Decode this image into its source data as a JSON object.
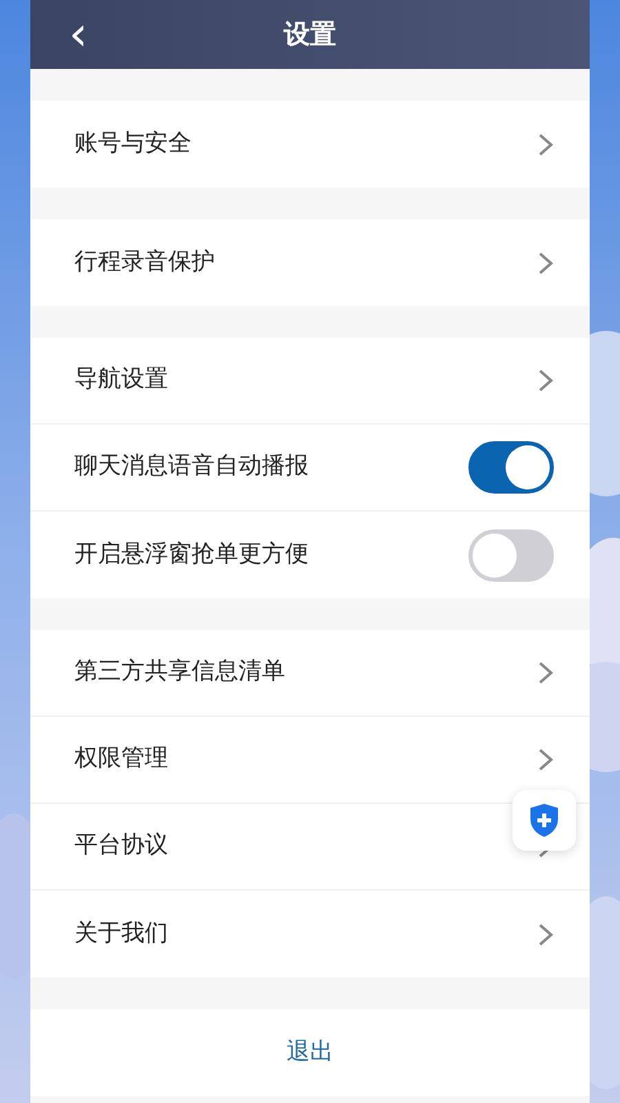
{
  "header": {
    "back": "‹",
    "title": "设置"
  },
  "groups": [
    [
      {
        "kind": "link",
        "label": "账号与安全"
      }
    ],
    [
      {
        "kind": "link",
        "label": "行程录音保护"
      }
    ],
    [
      {
        "kind": "link",
        "label": "导航设置"
      },
      {
        "kind": "toggle",
        "label": "聊天消息语音自动播报",
        "on": true
      },
      {
        "kind": "toggle",
        "label": "开启悬浮窗抢单更方便",
        "on": false
      }
    ],
    [
      {
        "kind": "link",
        "label": "第三方共享信息清单"
      },
      {
        "kind": "link",
        "label": "权限管理"
      },
      {
        "kind": "link",
        "label": "平台协议"
      },
      {
        "kind": "link",
        "label": "关于我们"
      }
    ]
  ],
  "logout": "退出"
}
